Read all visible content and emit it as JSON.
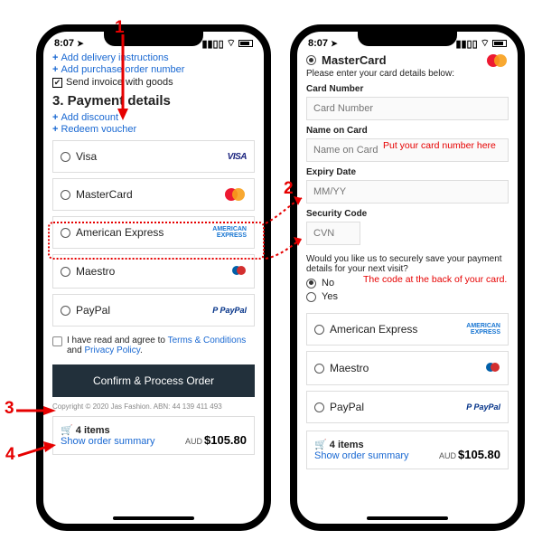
{
  "status": {
    "time": "8:07",
    "loc_glyph": "➤"
  },
  "annotations": {
    "n1": "1",
    "n2": "2",
    "n3": "3",
    "n4": "4",
    "note_card": "Put your card number here",
    "note_cvn": "The code at the back of your card."
  },
  "left": {
    "links": {
      "delivery": "Add delivery instructions",
      "po": "Add purchase order number",
      "invoice": "Send invoice with goods"
    },
    "heading": "3. Payment details",
    "discount": "Add discount",
    "voucher": "Redeem voucher",
    "options": {
      "visa": "Visa",
      "mc": "MasterCard",
      "amex": "American Express",
      "maestro": "Maestro",
      "paypal": "PayPal"
    },
    "agree_pre": "I have read and agree to ",
    "tc": "Terms & Conditions",
    "agree_mid": " and ",
    "pp": "Privacy Policy",
    "agree_post": ".",
    "confirm": "Confirm & Process Order",
    "copyright": "Copyright © 2020 Jas Fashion. ABN: 44 139 411 493",
    "cart_items": "4 items",
    "cart_show": "Show order summary",
    "cart_cur": "AUD",
    "cart_total": "$105.80",
    "logos": {
      "visa": "VISA",
      "amex_l1": "AMERICAN",
      "amex_l2": "EXPRESS",
      "paypal": "P PayPal"
    }
  },
  "right": {
    "heading": "MasterCard",
    "sub": "Please enter your card details below:",
    "f_card_l": "Card Number",
    "f_card_p": "Card Number",
    "f_name_l": "Name on Card",
    "f_name_p": "Name on Card",
    "f_exp_l": "Expiry Date",
    "f_exp_p": "MM/YY",
    "f_cvn_l": "Security Code",
    "f_cvn_p": "CVN",
    "save_q": "Would you like us to securely save your payment details for your next visit?",
    "no": "No",
    "yes": "Yes",
    "options": {
      "amex": "American Express",
      "maestro": "Maestro",
      "paypal": "PayPal"
    },
    "cart_items": "4 items",
    "cart_show": "Show order summary",
    "cart_cur": "AUD",
    "cart_total": "$105.80"
  }
}
